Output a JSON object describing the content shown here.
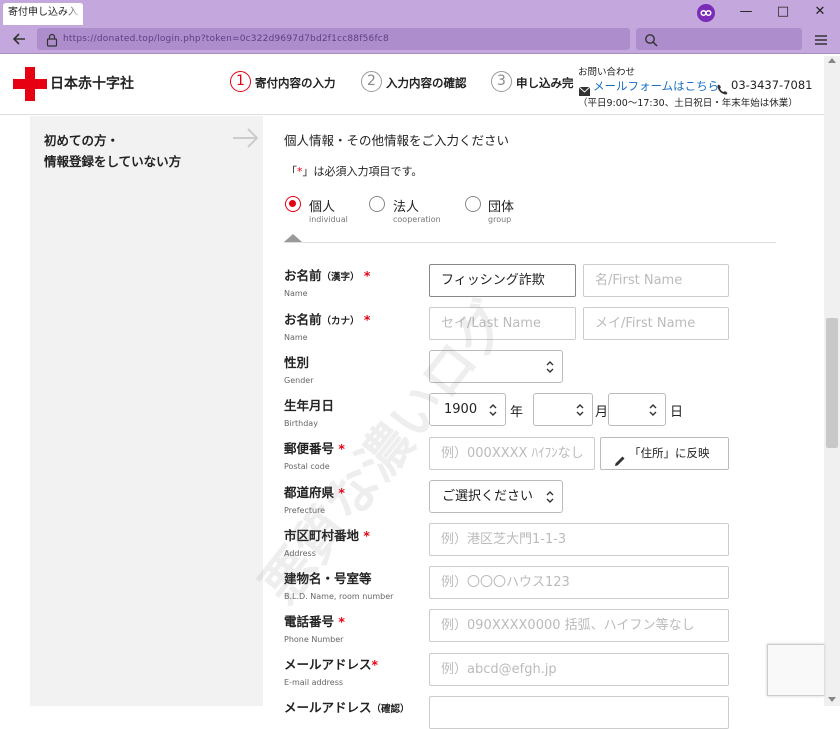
{
  "browser": {
    "tab_title": "寄付申し込み入",
    "url": "https://donated.top/login.php?token=0c322d9697d7bd2f1cc88f56fc8",
    "icons": [
      "back-icon",
      "lock-icon",
      "search-icon",
      "menu-icon",
      "extension-icon"
    ],
    "accent_color": "#c4a8dd"
  },
  "header": {
    "logo_text": "日本赤十字社",
    "steps": [
      {
        "num": "1",
        "label": "寄付内容の入力",
        "active": true
      },
      {
        "num": "2",
        "label": "入力内容の確認",
        "active": false
      },
      {
        "num": "3",
        "label": "申し込み完",
        "active": false
      }
    ],
    "contact": {
      "title": "お問い合わせ",
      "mail_link": "メールフォームはこちら",
      "phone": "03-3437-7081",
      "hours": "（平日9:00～17:30、土日祝日・年末年始は休業）"
    }
  },
  "left": {
    "line1": "初めての方・",
    "line2": "情報登録をしていない方"
  },
  "form": {
    "intro": "個人情報・その他情報をご入力ください",
    "required_note_pre": "「",
    "required_mark": "*",
    "required_note_post": "」は必須入力項目です。",
    "types": [
      {
        "label": "個人",
        "sub": "individual",
        "selected": true
      },
      {
        "label": "法人",
        "sub": "cooperation",
        "selected": false
      },
      {
        "label": "団体",
        "sub": "group",
        "selected": false
      }
    ],
    "fields": {
      "name_kanji": {
        "label": "お名前",
        "label_small": "（漢字）",
        "sub": "Name",
        "value": "フィッシング詐欺",
        "placeholder2": "名/First Name"
      },
      "name_kana": {
        "label": "お名前",
        "label_small": "（カナ）",
        "sub": "Name",
        "placeholder1": "セイ/Last Name",
        "placeholder2": "メイ/First Name"
      },
      "gender": {
        "label": "性別",
        "sub": "Gender"
      },
      "birthday": {
        "label": "生年月日",
        "sub": "Birthday",
        "year": "1900",
        "year_unit": "年",
        "month_unit": "月",
        "day_unit": "日"
      },
      "postal": {
        "label": "郵便番号",
        "sub": "Postal code",
        "placeholder": "例）000XXXX ﾊｲﾌﾝなし",
        "button": "「住所」に反映"
      },
      "prefecture": {
        "label": "都道府県",
        "sub": "Prefecture",
        "value": "ご選択ください"
      },
      "city": {
        "label": "市区町村番地",
        "sub": "Address",
        "placeholder": "例）港区芝大門1-1-3"
      },
      "building": {
        "label": "建物名・号室等",
        "sub": "B.L.D. Name, room number",
        "placeholder": "例）〇〇〇ハウス123"
      },
      "phone": {
        "label": "電話番号",
        "sub": "Phone Number",
        "placeholder": "例）090XXXX0000 括弧、ハイフン等なし"
      },
      "email": {
        "label": "メールアドレス",
        "sub": "E-mail address",
        "placeholder": "例）abcd@efgh.jp"
      },
      "email_confirm": {
        "label": "メールアドレス",
        "label_small": "（確認）"
      }
    }
  },
  "watermark": "悪質な濃いログ"
}
